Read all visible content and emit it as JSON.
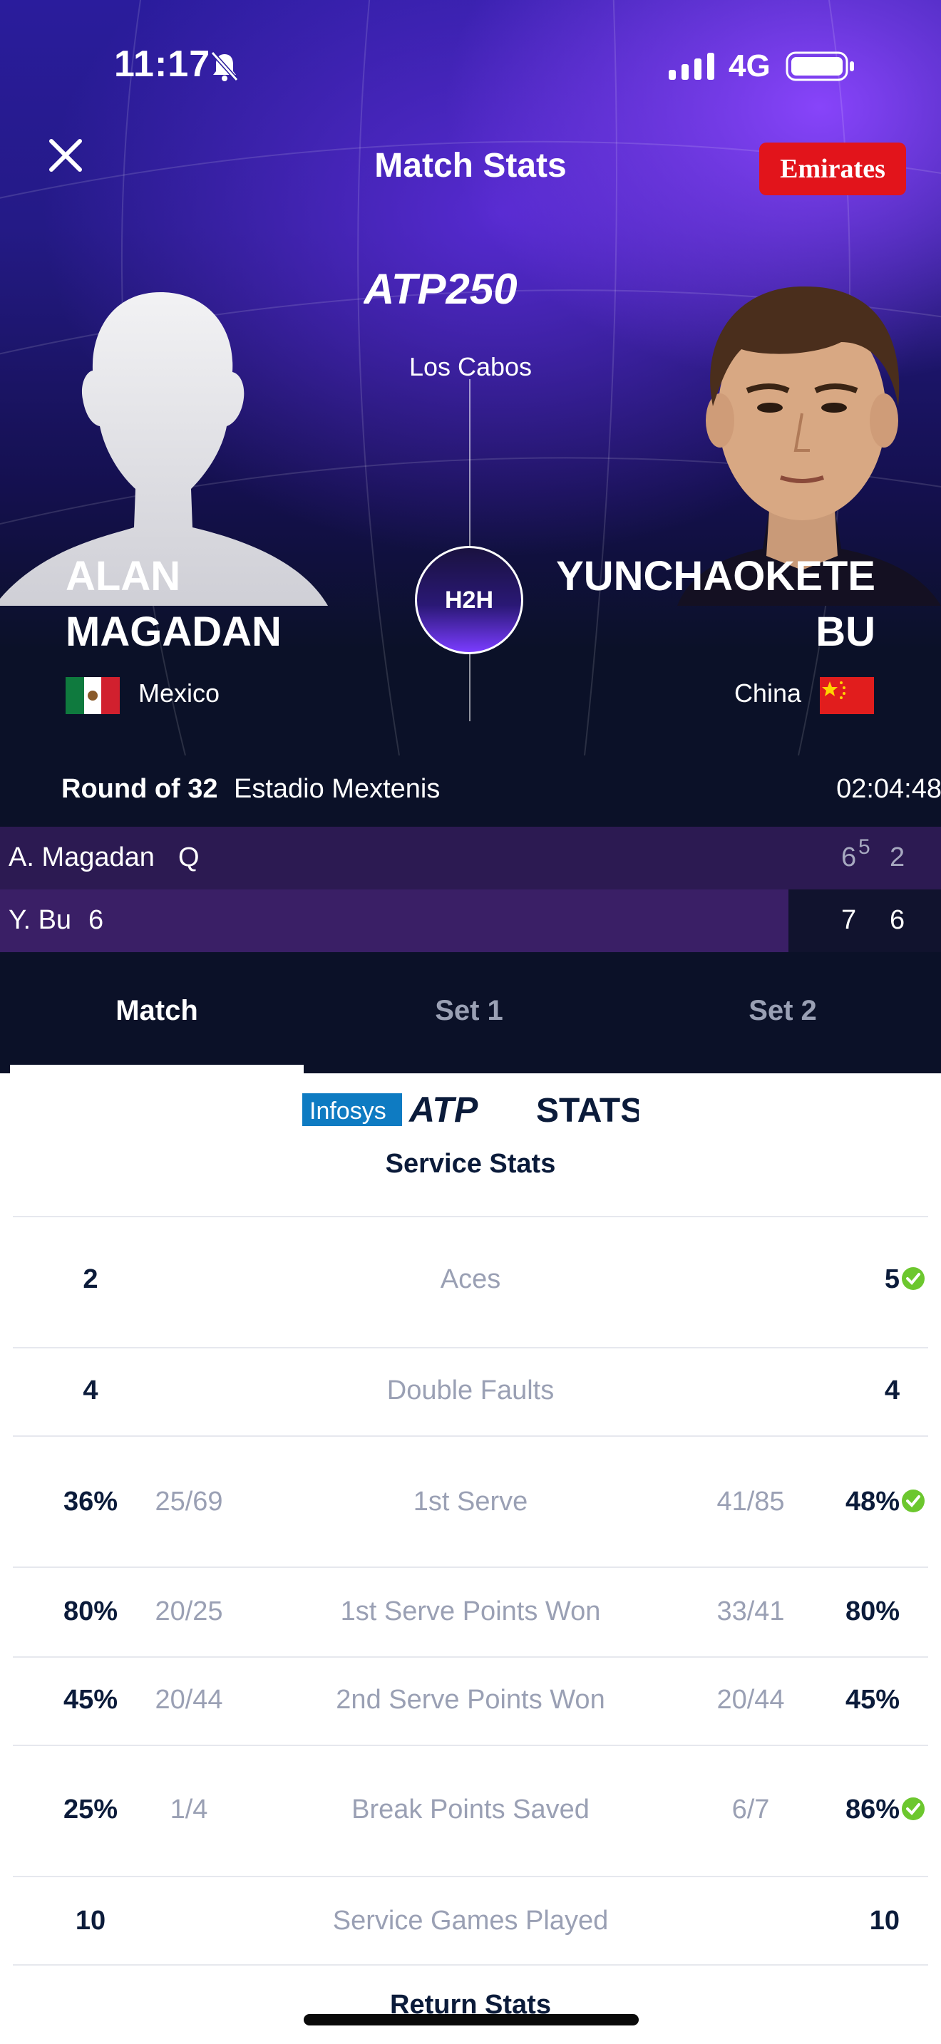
{
  "status_bar": {
    "time": "11:17",
    "network": "4G"
  },
  "header": {
    "title": "Match Stats",
    "sponsor": "Emirates"
  },
  "tournament": {
    "logo_text": "ATP250",
    "location": "Los Cabos",
    "h2h_label": "H2H"
  },
  "player1": {
    "name": "ALAN\nMAGADAN",
    "country": "Mexico"
  },
  "player2": {
    "name": "YUNCHAOKETE\nBU",
    "country": "China"
  },
  "match_info": {
    "round": "Round of 32",
    "court": "Estadio Mextenis",
    "duration": "02:04:48"
  },
  "scoreboard": {
    "row1": {
      "name": "A. Magadan",
      "seed": "Q",
      "set1": "6",
      "tiebreak": "5",
      "set2": "2"
    },
    "row2": {
      "name": "Y. Bu",
      "seed": "6",
      "set1": "7",
      "set2": "6"
    }
  },
  "tabs": [
    {
      "label": "Match"
    },
    {
      "label": "Set 1"
    },
    {
      "label": "Set 2"
    }
  ],
  "stats_brand": {
    "infosys": "Infosys",
    "atp": "ATP",
    "stats": "STATS"
  },
  "service_stats": {
    "title": "Service Stats",
    "rows": [
      {
        "label": "Aces",
        "left": "2",
        "right": "5",
        "leader": "right"
      },
      {
        "label": "Double Faults",
        "left": "4",
        "right": "4"
      },
      {
        "label": "1st Serve",
        "left": "36%",
        "left_frac": "25/69",
        "right_frac": "41/85",
        "right": "48%",
        "leader": "right"
      },
      {
        "label": "1st Serve Points Won",
        "left": "80%",
        "left_frac": "20/25",
        "right_frac": "33/41",
        "right": "80%"
      },
      {
        "label": "2nd Serve Points Won",
        "left": "45%",
        "left_frac": "20/44",
        "right_frac": "20/44",
        "right": "45%"
      },
      {
        "label": "Break Points Saved",
        "left": "25%",
        "left_frac": "1/4",
        "right_frac": "6/7",
        "right": "86%",
        "leader": "right"
      },
      {
        "label": "Service Games Played",
        "left": "10",
        "right": "10"
      }
    ]
  },
  "return_stats": {
    "title": "Return Stats"
  },
  "colors": {
    "accent_purple": "#7a3cff",
    "win_green": "#6cc72e",
    "sponsor_red": "#e2141b",
    "navy": "#0b1128"
  }
}
